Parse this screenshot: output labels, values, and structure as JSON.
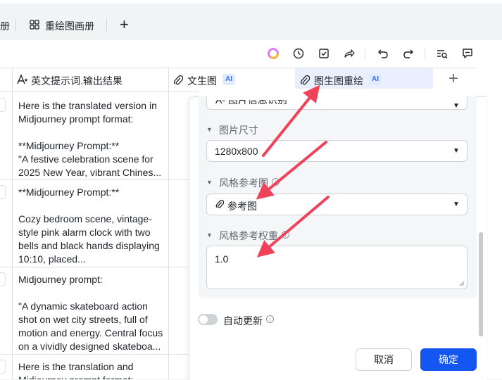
{
  "view_tabs": {
    "partial_tab_label": "册",
    "redraw_gallery_label": "重绘图画册",
    "add_tab_symbol": "+"
  },
  "columns": {
    "english_prompt": "英文提示词.输出结果",
    "text_to_image": "文生图",
    "image_to_image": "图生图重绘",
    "ai_badge": "AI",
    "add_column_symbol": "+"
  },
  "rows": [
    {
      "text": "Here is the translated version in Midjourney prompt format:\n\n**Midjourney Prompt:**\n\"A festive celebration scene for 2025 New Year, vibrant Chines..."
    },
    {
      "text": "**Midjourney Prompt:**\n\nCozy bedroom scene, vintage-style pink alarm clock with two bells and black hands displaying 10:10, placed..."
    },
    {
      "text": "Midjourney prompt:\n\n\"A dynamic skateboard action shot on wet city streets, full of motion and energy. Central focus on a vividly designed skateboa..."
    },
    {
      "text": "Here is the translation and Midjourney prompt format:"
    }
  ],
  "panel": {
    "cut_off_select_value": "A- 图片信息识别",
    "image_size_label": "图片尺寸",
    "image_size_value": "1280x800",
    "style_ref_label": "风格参考图",
    "style_ref_value": "参考图",
    "style_weight_label": "风格参考权重",
    "style_weight_value": "1.0",
    "auto_update_label": "自动更新",
    "auto_update_on": false,
    "cancel_label": "取消",
    "confirm_label": "确定"
  },
  "colors": {
    "primary": "#1456f0",
    "annotation_arrow": "#f0435a",
    "active_header": "#e9effd"
  }
}
